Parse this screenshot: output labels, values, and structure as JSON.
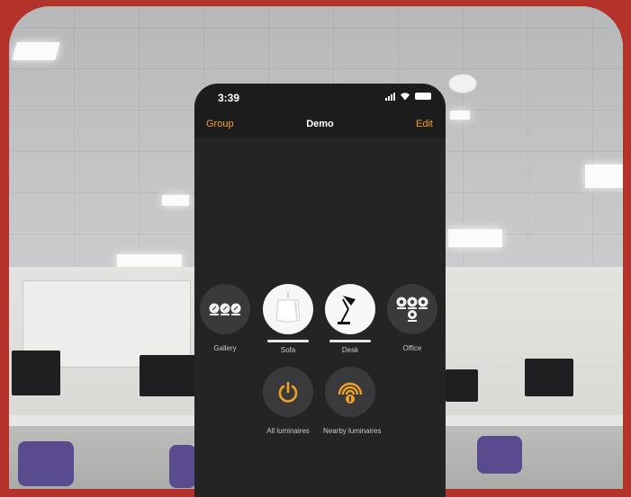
{
  "status_bar": {
    "time": "3:39"
  },
  "nav": {
    "left": "Group",
    "title": "Demo",
    "right": "Edit"
  },
  "groups": [
    {
      "label": "Gallery",
      "icon": "three-lamps-icon"
    },
    {
      "label": "Sofa",
      "icon": "pendant-lamp-icon"
    },
    {
      "label": "Desk",
      "icon": "desk-lamp-icon"
    },
    {
      "label": "Office",
      "icon": "four-lamps-icon"
    }
  ],
  "actions": [
    {
      "label": "All luminaires",
      "icon": "power-icon"
    },
    {
      "label": "Nearby luminaires",
      "icon": "nearby-signal-icon"
    }
  ],
  "colors": {
    "accent": "#f0a023",
    "frame": "#b3322a",
    "phone_bg": "#242425"
  }
}
